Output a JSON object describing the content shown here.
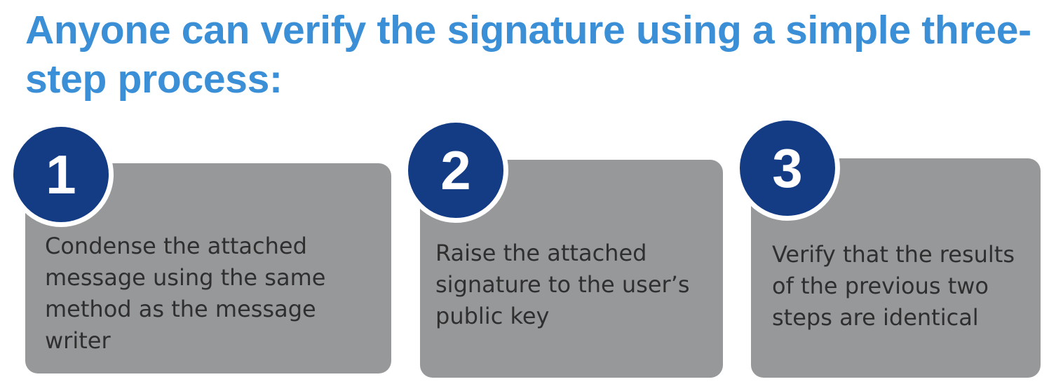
{
  "title": "Anyone can verify the signature using a simple three-step process:",
  "steps": [
    {
      "number": "1",
      "text": "Condense the attached message using the same method as the message writer"
    },
    {
      "number": "2",
      "text": "Raise the attached signature to the user’s public key"
    },
    {
      "number": "3",
      "text": "Verify that the results of the previous two steps are identical"
    }
  ],
  "colors": {
    "title": "#3a8fd6",
    "circle": "#133c85",
    "box": "#97989a",
    "box_text": "#2f2f30"
  }
}
